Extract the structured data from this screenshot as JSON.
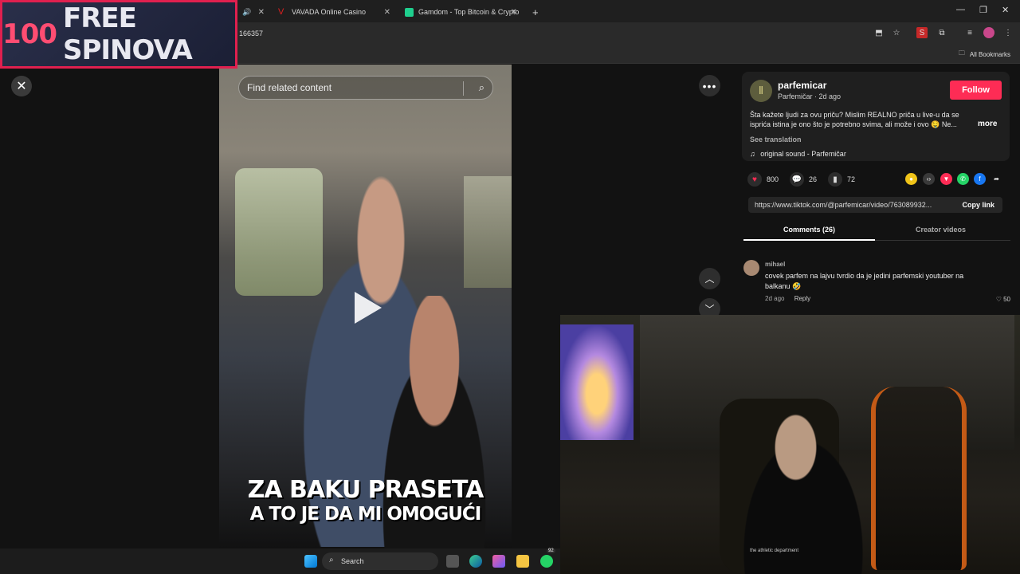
{
  "browser": {
    "tabs": [
      {
        "label": "VAVADA Online Casino"
      },
      {
        "label": "Gamdom - Top Bitcoin & Crypto"
      }
    ],
    "url": "166357",
    "bookmarks_label": "All Bookmarks"
  },
  "promo": {
    "number": "100",
    "text": "FREE SPINOVA"
  },
  "video": {
    "search_placeholder": "Find related content",
    "caption_line1": "ZA BAKU PRASETA",
    "caption_line2": "A TO JE DA MI OMOGUĆI"
  },
  "creator": {
    "name": "parfemicar",
    "meta": "Parfemičar · 2d ago",
    "follow_label": "Follow",
    "description": "Šta kažete ljudi za ovu priču? Mislim REALNO priča u live-u da se isprića istina je ono što je potrebno svima, ali može i ovo 🤤 Ne...",
    "more_label": "more",
    "see_translation": "See translation",
    "sound": "original sound - Parfemičar"
  },
  "stats": {
    "likes": "800",
    "comments": "26",
    "saves": "72"
  },
  "link": {
    "url": "https://www.tiktok.com/@parfemicar/video/763089932...",
    "copy_label": "Copy link"
  },
  "panel_tabs": {
    "comments": "Comments (26)",
    "creator_videos": "Creator videos"
  },
  "comment": {
    "user": "mihael",
    "text": "covek parfem na lajvu tvrdio da je jedini parfemski youtuber na balkanu 🤣",
    "time": "2d ago",
    "reply": "Reply",
    "likes": "50"
  },
  "webcam": {
    "shirt_text": "the athletic department"
  },
  "taskbar": {
    "search_label": "Search",
    "badge": "92"
  }
}
